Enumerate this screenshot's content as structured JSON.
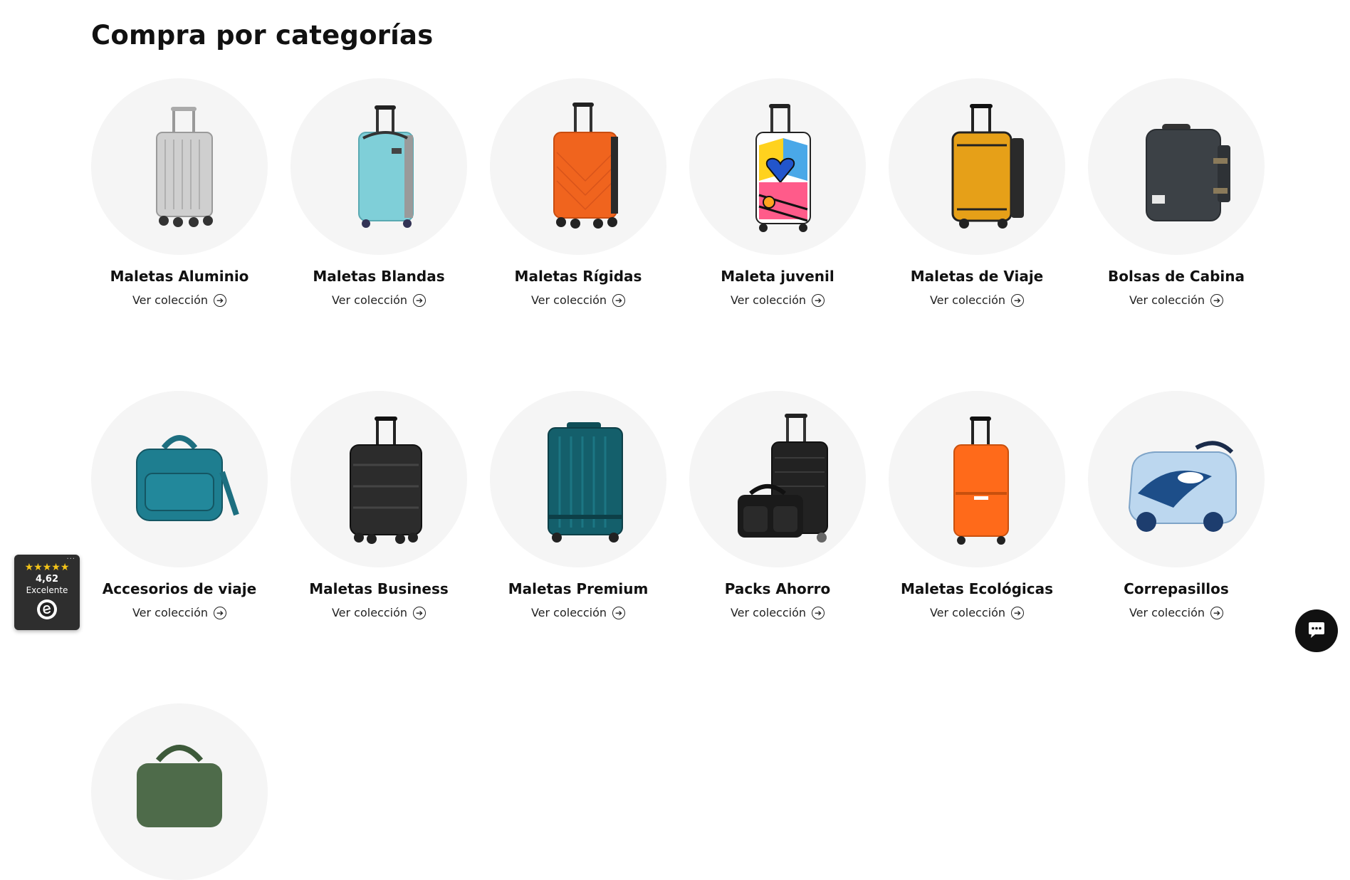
{
  "page_title": "Compra por categorías",
  "link_label": "Ver colección",
  "categories": [
    {
      "title": "Maletas Aluminio"
    },
    {
      "title": "Maletas Blandas"
    },
    {
      "title": "Maletas Rígidas"
    },
    {
      "title": "Maleta juvenil"
    },
    {
      "title": "Maletas de Viaje"
    },
    {
      "title": "Bolsas de Cabina"
    },
    {
      "title": "Accesorios de viaje"
    },
    {
      "title": "Maletas Business"
    },
    {
      "title": "Maletas Premium"
    },
    {
      "title": "Packs Ahorro"
    },
    {
      "title": "Maletas Ecológicas"
    },
    {
      "title": "Correpasillos"
    }
  ],
  "rating_widget": {
    "stars": "★★★★★",
    "score": "4,62",
    "label": "Excelente",
    "menu_dots": "···"
  },
  "colors": {
    "circle_bg": "#f5f5f5",
    "widget_bg": "#2e2e2e",
    "star": "#f5c518",
    "chat_bg": "#111111"
  },
  "icons": {
    "link": "arrow-right-circle-icon",
    "chat": "chat-bubble-icon",
    "badge": "trusted-shops-e-icon"
  }
}
